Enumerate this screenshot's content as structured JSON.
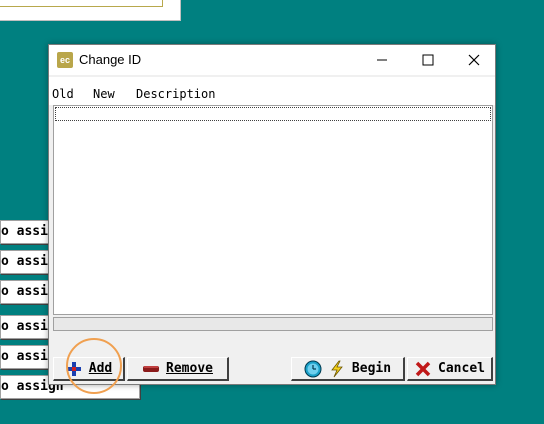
{
  "dialog": {
    "title": "Change ID",
    "app_icon": "ec",
    "columns": [
      "Old",
      "New",
      "Description"
    ],
    "buttons": {
      "add": "Add",
      "remove": "Remove",
      "begin": "Begin",
      "cancel": "Cancel"
    }
  },
  "background": {
    "buttons": [
      "o assig",
      "o assig",
      "o assig",
      "o assig",
      "o assig",
      "o assign"
    ]
  },
  "colors": {
    "desktop": "#008080",
    "annotation_circle": "#f0a050"
  }
}
